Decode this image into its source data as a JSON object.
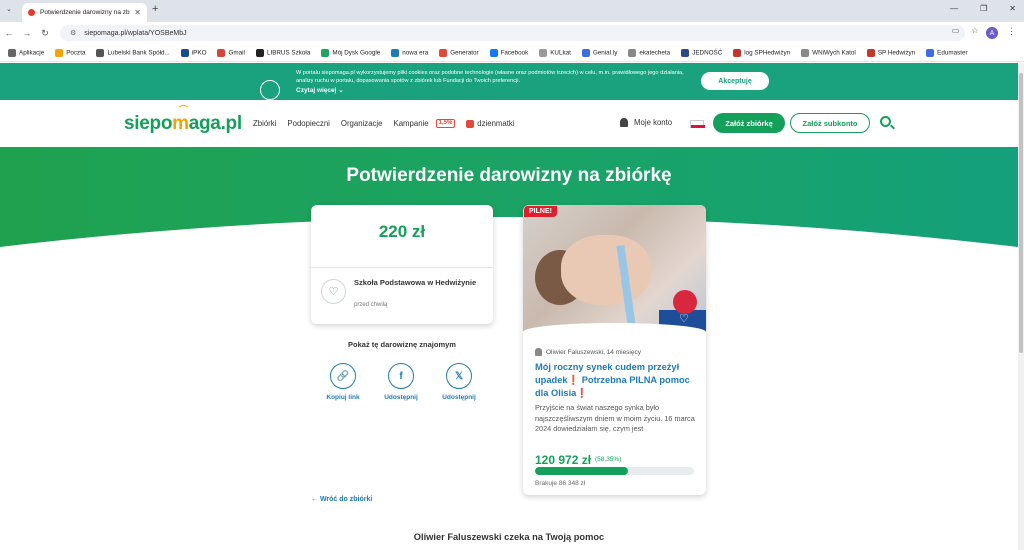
{
  "browser": {
    "tab_title": "Potwierdzenie darowizny na zb",
    "url": "siepomaga.pl/wplata/YOSBeMbJ",
    "profile_initial": "A"
  },
  "bookmarks": [
    {
      "label": "Aplikacje",
      "color": "#666"
    },
    {
      "label": "Poczta",
      "color": "#f2a400"
    },
    {
      "label": "Lubelski Bank Spółd...",
      "color": "#555"
    },
    {
      "label": "iPKO",
      "color": "#1a4a8a"
    },
    {
      "label": "Gmail",
      "color": "#d44638"
    },
    {
      "label": "LIBRUS Szkoła",
      "color": "#222"
    },
    {
      "label": "Mój Dysk Google",
      "color": "#1fa463"
    },
    {
      "label": "nowa era",
      "color": "#1e7ab8"
    },
    {
      "label": "Generator",
      "color": "#e14a38"
    },
    {
      "label": "Facebook",
      "color": "#1877f2"
    },
    {
      "label": "KULkat",
      "color": "#999"
    },
    {
      "label": "Genial.ly",
      "color": "#3f6de0"
    },
    {
      "label": "ekatecheta",
      "color": "#888"
    },
    {
      "label": "JEDNOŚĆ",
      "color": "#2a4a8a"
    },
    {
      "label": "log SPHedwiżyn",
      "color": "#c0392b"
    },
    {
      "label": "WNiWych Katol",
      "color": "#888"
    },
    {
      "label": "SP Hedwiżyn",
      "color": "#c0392b"
    },
    {
      "label": "Edumaster",
      "color": "#3f6de0"
    }
  ],
  "cookie": {
    "text": "W portalu siepomaga.pl wykorzystujemy pliki cookies oraz podobne technologie (własne oraz podmiotów trzecich) w celu, m.in. prawidłowego jego działania, analizy ruchu w portalu, dopasowania spotów z zbiórek lub Fundacji do Twoich preferencji.",
    "more": "Czytaj więcej",
    "accept": "Akceptuję"
  },
  "header": {
    "logo_a": "siepo",
    "logo_b": "m",
    "logo_c": "aga.pl",
    "nav": [
      "Zbiórki",
      "Podopieczni",
      "Organizacje",
      "Kampanie"
    ],
    "badge": "1,5%",
    "dzienmatki": "dzienmatki",
    "account": "Moje konto",
    "create_fundraiser": "Załóż zbiórkę",
    "create_subaccount": "Załóż subkonto"
  },
  "page": {
    "title": "Potwierdzenie darowizny na zbiórkę",
    "amount": "220 zł",
    "donor_name": "Szkoła Podstawowa w Hedwiżynie",
    "donor_time": "przed chwilą",
    "share_title": "Pokaż tę darowiznę znajomym",
    "share": [
      {
        "label": "Kopiuj link",
        "icon": "🔗"
      },
      {
        "label": "Udostępnij",
        "icon": "f"
      },
      {
        "label": "Udostępnij",
        "icon": "𝕏"
      }
    ],
    "back": "Wróć do zbiórki",
    "bottom": "Oliwier Faluszewski czeka na Twoją pomoc"
  },
  "campaign": {
    "badge": "PILNE!",
    "author": "Oliwier Faluszewski, 14 miesięcy",
    "title": "Mój roczny synek cudem przeżył upadek❗ Potrzebna PILNA pomoc dla Olisia❗",
    "description": "Przyjście na świat naszego synka było najszczęśliwszym dniem w moim życiu. 16 marca 2024 dowiedziałam się, czym jest",
    "raised": "120 972 zł",
    "percent": "(58,35%)",
    "progress": 0.5835,
    "missing": "Brakuje 86 348 zł"
  },
  "colors": {
    "brand": "#14a05a",
    "link": "#1e7ab8",
    "urgent": "#e01e2d"
  }
}
